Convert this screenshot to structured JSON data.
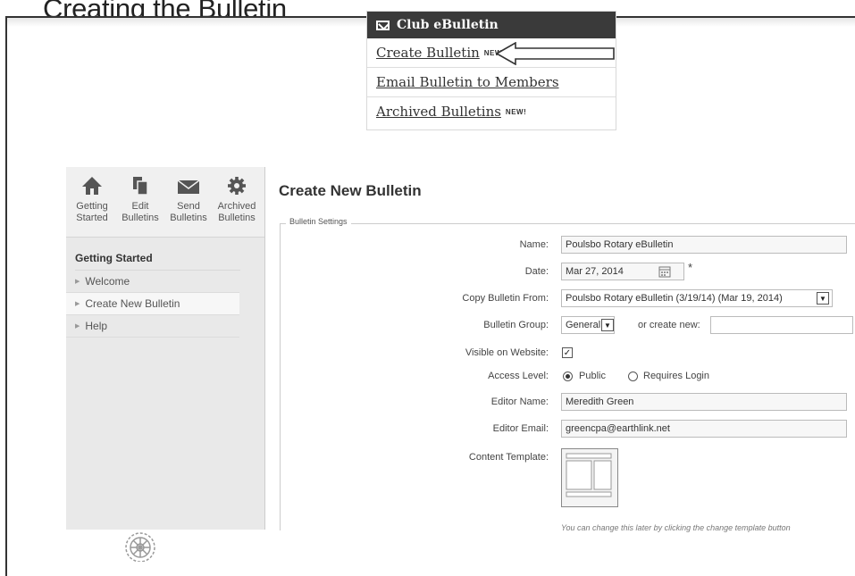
{
  "slide": {
    "title": "Creating the Bulletin"
  },
  "menu": {
    "title": "Club eBulletin",
    "items": [
      {
        "label": "Create Bulletin",
        "badge": "NEW!"
      },
      {
        "label": "Email Bulletin to Members",
        "badge": ""
      },
      {
        "label": "Archived Bulletins",
        "badge": "NEW!"
      }
    ]
  },
  "toolbar": {
    "items": [
      {
        "line1": "Getting",
        "line2": "Started",
        "icon": "home-icon"
      },
      {
        "line1": "Edit",
        "line2": "Bulletins",
        "icon": "documents-icon"
      },
      {
        "line1": "Send",
        "line2": "Bulletins",
        "icon": "envelope-icon"
      },
      {
        "line1": "Archived",
        "line2": "Bulletins",
        "icon": "gear-icon"
      }
    ]
  },
  "sidebar": {
    "heading": "Getting Started",
    "items": [
      "Welcome",
      "Create New Bulletin",
      "Help"
    ]
  },
  "main": {
    "title": "Create New Bulletin",
    "fieldset_legend": "Bulletin Settings",
    "labels": {
      "name": "Name:",
      "date": "Date:",
      "copy": "Copy Bulletin From:",
      "group": "Bulletin Group:",
      "visible": "Visible on Website:",
      "access": "Access Level:",
      "editor_name": "Editor Name:",
      "editor_email": "Editor Email:",
      "template": "Content Template:"
    },
    "values": {
      "name": "Poulsbo Rotary eBulletin",
      "date": "Mar 27, 2014",
      "required_mark": "*",
      "copy": "Poulsbo Rotary eBulletin (3/19/14) (Mar 19, 2014)",
      "group": "General",
      "or_create_new": "or create new:",
      "access_public": "Public",
      "access_login": "Requires Login",
      "editor_name": "Meredith Green",
      "editor_email": "greencpa@earthlink.net"
    },
    "visible_checked": true,
    "access_selected": "Public",
    "template_note": "You can change this later by clicking the change template button"
  }
}
